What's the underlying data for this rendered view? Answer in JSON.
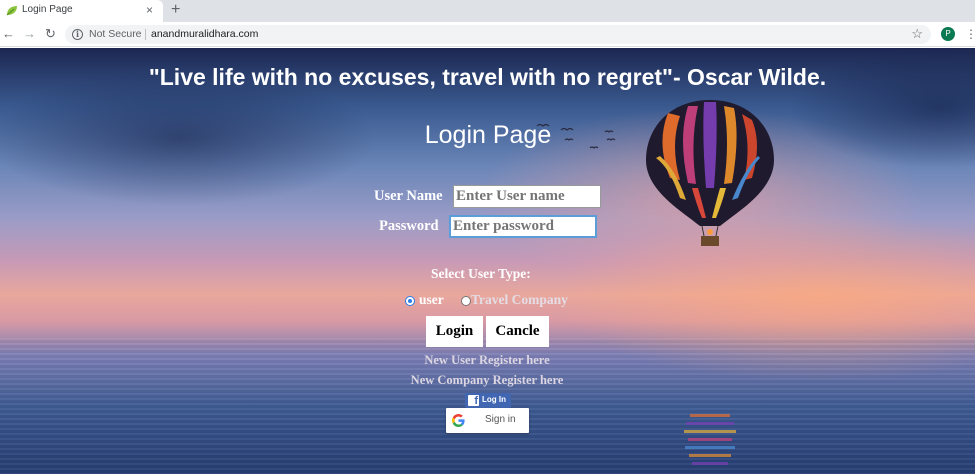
{
  "browser": {
    "tab_title": "Login Page",
    "tab_close": "×",
    "new_tab": "+",
    "back": "←",
    "forward": "→",
    "reload": "↻",
    "security_label": "Not Secure",
    "url": "anandmuralidhara.com",
    "bookmark": "☆",
    "profile_initial": "P",
    "menu": "⋮"
  },
  "page": {
    "quote": "\"Live life with no excuses, travel with no regret\"- Oscar Wilde.",
    "heading": "Login Page"
  },
  "form": {
    "username_label": "User Name",
    "username_placeholder": "Enter User name",
    "password_label": "Password",
    "password_placeholder": "Enter password",
    "user_type_label": "Select User Type:",
    "user_type_options": [
      {
        "label": "user",
        "selected": true
      },
      {
        "label": "Travel Company",
        "selected": false
      }
    ],
    "login_button": "Login",
    "cancel_button": "Cancle",
    "register_user_link": "New User Register here",
    "register_company_link": "New Company Register here"
  },
  "social": {
    "facebook_icon": "f",
    "facebook_label": "Log In",
    "google_label": "Sign in"
  },
  "colors": {
    "facebook_blue": "#4267b2",
    "radio_accent": "#2b7de9",
    "focus_border": "#5b9dd9"
  }
}
